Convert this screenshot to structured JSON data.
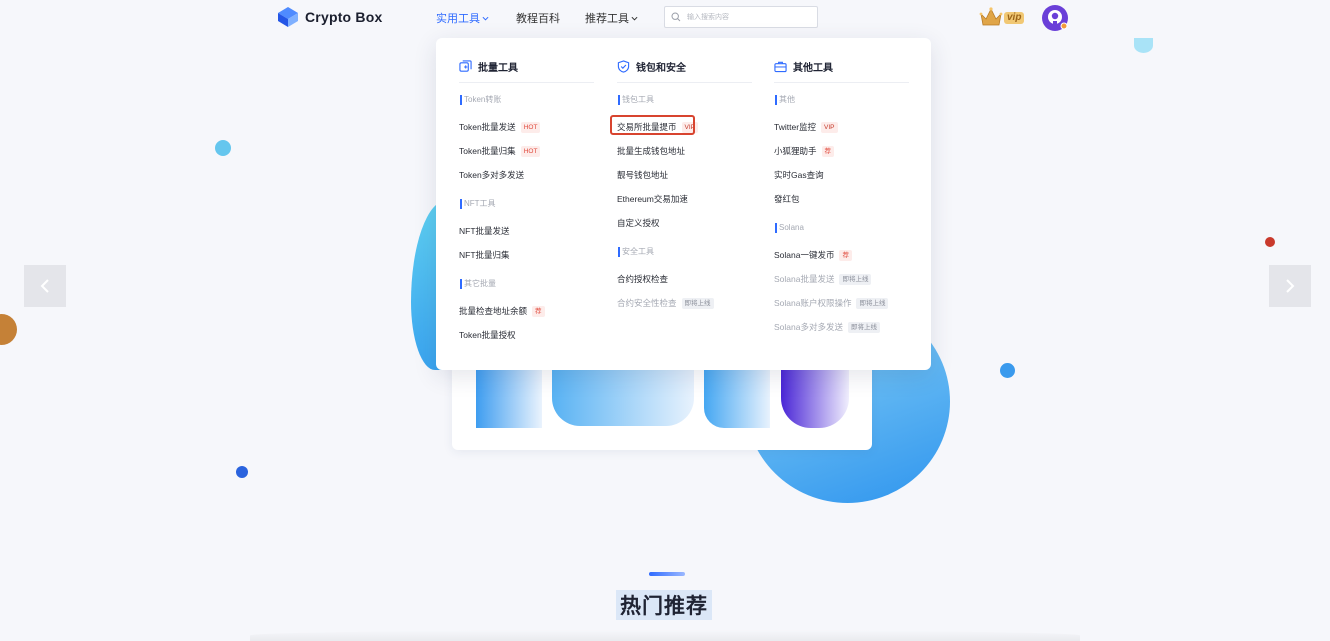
{
  "header": {
    "logo_text": "Crypto Box",
    "nav": [
      {
        "label": "实用工具",
        "has_dropdown": true,
        "active": true
      },
      {
        "label": "教程百科",
        "has_dropdown": false,
        "active": false
      },
      {
        "label": "推荐工具",
        "has_dropdown": true,
        "active": false
      }
    ],
    "search": {
      "placeholder": "输入搜索内容",
      "value": ""
    },
    "vip_label": "vip"
  },
  "dropdown": {
    "columns": [
      {
        "title": "批量工具",
        "icon": "copy-icon",
        "groups": [
          {
            "label": "Token转账",
            "items": [
              {
                "label": "Token批量发送",
                "tag": "HOT"
              },
              {
                "label": "Token批量归集",
                "tag": "HOT"
              },
              {
                "label": "Token多对多发送",
                "tag": ""
              }
            ]
          },
          {
            "label": "NFT工具",
            "items": [
              {
                "label": "NFT批量发送",
                "tag": ""
              },
              {
                "label": "NFT批量归集",
                "tag": ""
              }
            ]
          },
          {
            "label": "其它批量",
            "items": [
              {
                "label": "批量检查地址余额",
                "tag": "荐"
              },
              {
                "label": "Token批量授权",
                "tag": ""
              }
            ]
          }
        ]
      },
      {
        "title": "钱包和安全",
        "icon": "shield-check-icon",
        "groups": [
          {
            "label": "钱包工具",
            "items": [
              {
                "label": "交易所批量提币",
                "tag": "VIP"
              },
              {
                "label": "批量生成钱包地址",
                "tag": ""
              },
              {
                "label": "靓号钱包地址",
                "tag": ""
              },
              {
                "label": "Ethereum交易加速",
                "tag": ""
              },
              {
                "label": "自定义授权",
                "tag": ""
              }
            ]
          },
          {
            "label": "安全工具",
            "items": [
              {
                "label": "合约授权检查",
                "tag": ""
              },
              {
                "label": "合约安全性检查",
                "tag": "即将上线"
              }
            ]
          }
        ]
      },
      {
        "title": "其他工具",
        "icon": "briefcase-icon",
        "groups": [
          {
            "label": "其他",
            "items": [
              {
                "label": "Twitter监控",
                "tag": "VIP"
              },
              {
                "label": "小狐狸助手",
                "tag": "荐"
              },
              {
                "label": "实时Gas查询",
                "tag": ""
              },
              {
                "label": "發红包",
                "tag": ""
              }
            ]
          },
          {
            "label": "Solana",
            "items": [
              {
                "label": "Solana一键发币",
                "tag": "荐"
              },
              {
                "label": "Solana批量发送",
                "tag": "即将上线"
              },
              {
                "label": "Solana账户权限操作",
                "tag": "即将上线"
              },
              {
                "label": "Solana多对多发送",
                "tag": "即将上线"
              }
            ]
          }
        ]
      }
    ]
  },
  "section": {
    "title": "热门推荐"
  },
  "colors": {
    "accent": "#2f6bff",
    "hot_tag": "#e0483b",
    "highlight_box": "#d8442f"
  }
}
